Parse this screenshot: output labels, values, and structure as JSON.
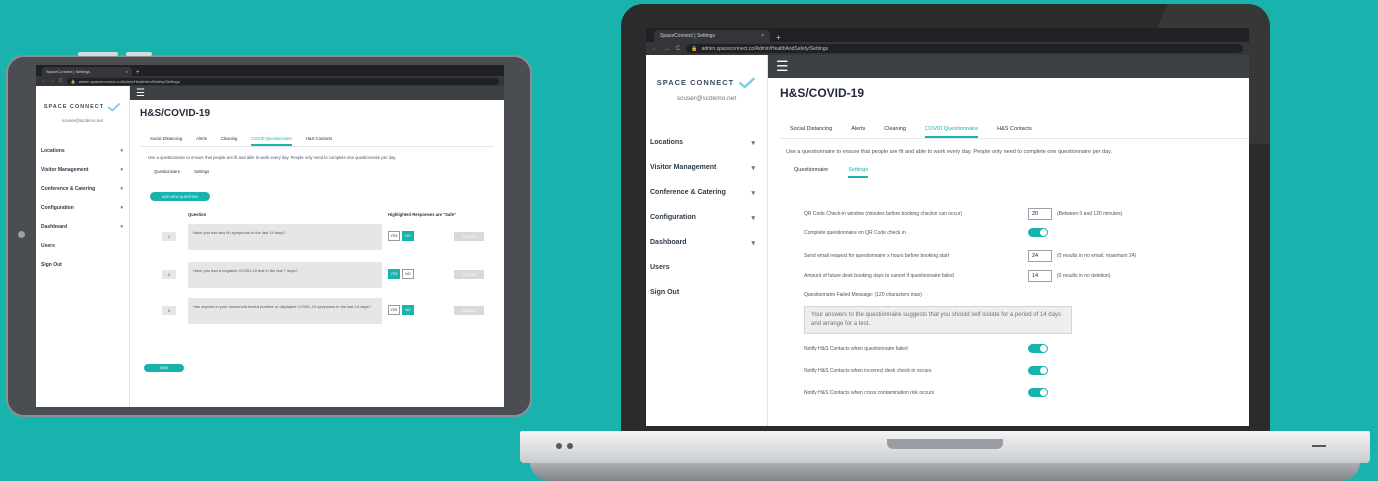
{
  "browser": {
    "tab_title": "SpaceConnect | Settings",
    "tab_close": "×",
    "new_tab": "+",
    "url": "admin.spaceconnect.co/Admin/HealthAndSafety/Settings",
    "nav_back": "←",
    "nav_forward": "→",
    "nav_reload": "C"
  },
  "sidebar": {
    "logo": "SPACE CONNECT",
    "user": "scuser@scdemo.net",
    "items": [
      {
        "label": "Locations",
        "caret": "▾"
      },
      {
        "label": "Visitor Management",
        "caret": "▾"
      },
      {
        "label": "Conference & Catering",
        "caret": "▾"
      },
      {
        "label": "Configuration",
        "caret": "▾"
      },
      {
        "label": "Dashboard",
        "caret": "▾"
      },
      {
        "label": "Users",
        "caret": ""
      },
      {
        "label": "Sign Out",
        "caret": ""
      }
    ]
  },
  "page": {
    "title": "H&S/COVID-19",
    "tabs": [
      "Social Distancing",
      "Alerts",
      "Cleaning",
      "COVID Questionnaire",
      "H&S Contacts"
    ],
    "description": "Use a questionnaire to ensure that people are fit and able to work every day. People only need to complete one questionnaire per day.",
    "subtabs": [
      "Questionnaire",
      "Settings"
    ]
  },
  "tablet": {
    "add_button": "ADD NEW QUESTION",
    "col_question": "Question",
    "col_safe": "Highlighted Responses are \"Safe\"",
    "questions": [
      {
        "num": "1",
        "text": "Have you had any flu symptoms in the last 14 days?",
        "yes": "YES",
        "no": "NO",
        "safe": "no",
        "delete": "DELETE"
      },
      {
        "num": "2",
        "text": "Have you had a negative COVID-19 test in the last 7 days?",
        "yes": "YES",
        "no": "NO",
        "safe": "yes",
        "delete": "DELETE"
      },
      {
        "num": "3",
        "text": "Has anyone in your household tested positive or displayed COVID-19 symptoms in the last 14 days?",
        "yes": "YES",
        "no": "NO",
        "safe": "no",
        "delete": "DELETE"
      }
    ],
    "save_button": "SAVE"
  },
  "laptop": {
    "settings": {
      "qr_window_label": "QR Code Check-in window (minutes before booking checkin can occur)",
      "qr_window_value": "20",
      "qr_window_hint": "(Between 0 and 120 minutes)",
      "complete_on_qr_label": "Complete questionnaire on QR Code check in",
      "email_request_label": "Send email request for questionnaire x hours before booking start",
      "email_request_value": "24",
      "email_request_hint": "(0 results in no email, maximum 24)",
      "future_days_label": "Amount of future desk booking days to cancel if questionnaire failed",
      "future_days_value": "14",
      "future_days_hint": "(0 results in no deletion)",
      "failed_msg_label": "Questionnaire Failed Message: (120 characters max)",
      "failed_msg_value": "Your answers to the questionnaire suggests that you should self isolate for a period of 14 days and arrange for a test.",
      "notify_failed_label": "Notify H&S Contacts when questionnaire failed",
      "notify_incorrect_label": "Notify H&S Contacts when incorrect desk check-in occurs",
      "notify_cross_label": "Notify H&S Contacts when cross contamination risk occurs"
    }
  },
  "colors": {
    "accent": "#19b3ad",
    "background": "#19b3ad",
    "topbar": "#3d4146"
  },
  "icons": {
    "logo": "checkmark-logo-icon",
    "menu": "hamburger-icon",
    "lock": "lock-icon"
  }
}
